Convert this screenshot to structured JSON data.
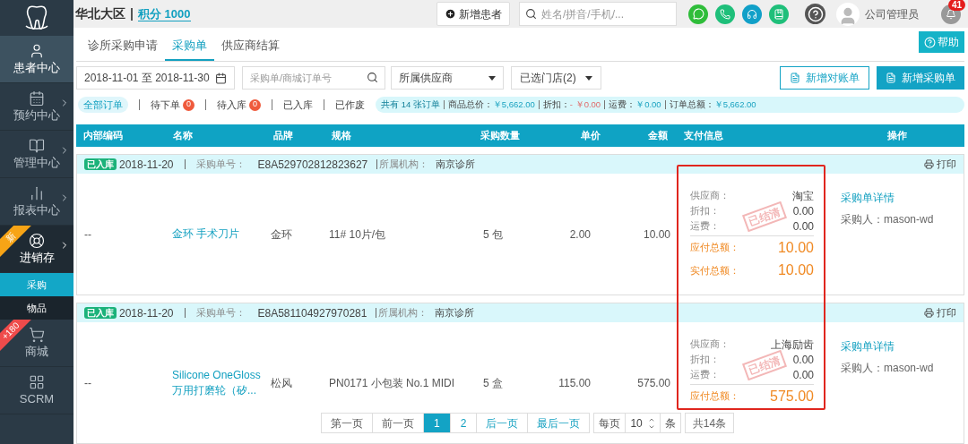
{
  "sidebar": {
    "items": [
      {
        "label": "患者中心",
        "selected": true,
        "expandable": false
      },
      {
        "label": "预约中心",
        "selected": false,
        "expandable": true
      },
      {
        "label": "管理中心",
        "selected": false,
        "expandable": true
      },
      {
        "label": "报表中心",
        "selected": false,
        "expandable": true
      },
      {
        "label": "进销存",
        "selected": false,
        "expandable": true,
        "badge": "新",
        "color": "#f7a416",
        "children": [
          {
            "label": "采购",
            "selected": true
          },
          {
            "label": "物品",
            "selected": false
          }
        ]
      },
      {
        "label": "商城",
        "selected": false,
        "expandable": false,
        "badge": "+180",
        "color": "#ef4b4b"
      },
      {
        "label": "SCRM",
        "selected": false,
        "expandable": false
      }
    ]
  },
  "header": {
    "region": "华北大区",
    "points": "积分 1000",
    "new_patient_button": "新增患者",
    "search": {
      "placeholder": "姓名/拼音/手机/..."
    },
    "user": "公司管理员",
    "notification_count": "41"
  },
  "tabs": [
    {
      "label": "诊所采购申请",
      "selected": false
    },
    {
      "label": "采购单",
      "selected": true
    },
    {
      "label": "供应商结算",
      "selected": false
    }
  ],
  "help_button": "帮助",
  "filters": {
    "date_range": "2018-11-01 至 2018-11-30",
    "order_search": {
      "placeholder": "采购单/商城订单号"
    },
    "supplier": "所属供应商",
    "stores": "已选门店(2)",
    "buttons": [
      {
        "label": "新增对账单",
        "kind": "outline"
      },
      {
        "label": "新增采购单",
        "kind": "primary"
      }
    ]
  },
  "status_tabs": [
    {
      "label": "全部订单",
      "selected": true
    },
    {
      "label": "待下单",
      "selected": false,
      "count": "0"
    },
    {
      "label": "待入库",
      "selected": false,
      "count": "0"
    },
    {
      "label": "已入库",
      "selected": false
    },
    {
      "label": "已作废",
      "selected": false
    }
  ],
  "summary": {
    "order_count": "共有 14 张订单",
    "items": [
      {
        "label": "商品总价：",
        "value": "￥5,662.00",
        "kind": "normal"
      },
      {
        "label": "折扣：",
        "value": "- ￥0.00",
        "kind": "negative"
      },
      {
        "label": "运费：",
        "value": "￥0.00",
        "kind": "normal"
      },
      {
        "label": "订单总额：",
        "value": "￥5,662.00",
        "kind": "normal"
      }
    ]
  },
  "table": {
    "columns": [
      "内部编码",
      "名称",
      "品牌",
      "规格",
      "采购数量",
      "单价",
      "金额",
      "支付信息",
      "操作"
    ],
    "orders": [
      {
        "status": "已入库",
        "date": "2018-11-20",
        "order_no_label": "采购单号：",
        "order_no": "E8A529702812823627",
        "org_label": "所属机构：",
        "org": "南京诊所",
        "print": "打印",
        "item": {
          "code": "--",
          "name": "金环 手术刀片",
          "brand": "金环",
          "spec": "11# 10片/包",
          "qty": "5 包",
          "price": "2.00",
          "amount": "10.00"
        },
        "payment": [
          {
            "label": "供应商：",
            "value": "淘宝",
            "kind": "plain"
          },
          {
            "label": "折扣：",
            "value": "0.00",
            "kind": "plain"
          },
          {
            "label": "运费：",
            "value": "0.00",
            "kind": "plain"
          },
          {
            "label": "应付总额：",
            "value": "10.00",
            "kind": "total"
          },
          {
            "label": "实付总额：",
            "value": "10.00",
            "kind": "total"
          }
        ],
        "stamp": "已结清",
        "detail_link": "采购单详情",
        "buyer": "采购人：mason-wd"
      },
      {
        "status": "已入库",
        "date": "2018-11-20",
        "order_no_label": "采购单号：",
        "order_no": "E8A581104927970281",
        "org_label": "所属机构：",
        "org": "南京诊所",
        "print": "打印",
        "item": {
          "code": "--",
          "name": "Silicone OneGloss 万用打磨轮（矽...",
          "brand": "松风",
          "spec": "PN0171 小包装 No.1 MIDI",
          "qty": "5 盒",
          "price": "115.00",
          "amount": "575.00"
        },
        "payment": [
          {
            "label": "供应商：",
            "value": "上海励齿",
            "kind": "plain"
          },
          {
            "label": "折扣：",
            "value": "0.00",
            "kind": "plain"
          },
          {
            "label": "运费：",
            "value": "0.00",
            "kind": "plain"
          },
          {
            "label": "应付总额：",
            "value": "575.00",
            "kind": "total"
          }
        ],
        "stamp": "已结清",
        "detail_link": "采购单详情",
        "buyer": "采购人：mason-wd"
      }
    ]
  },
  "pagination": {
    "pages": [
      {
        "label": "第一页",
        "kind": "nav",
        "disabled": true
      },
      {
        "label": "前一页",
        "kind": "nav",
        "disabled": true
      },
      {
        "label": "1",
        "kind": "page",
        "selected": true
      },
      {
        "label": "2",
        "kind": "page",
        "selected": false
      },
      {
        "label": "后一页",
        "kind": "nav",
        "disabled": false
      },
      {
        "label": "最后一页",
        "kind": "nav",
        "disabled": false
      }
    ],
    "per_page_label": "每页",
    "per_page": "10",
    "unit": "条",
    "total": "共14条"
  }
}
